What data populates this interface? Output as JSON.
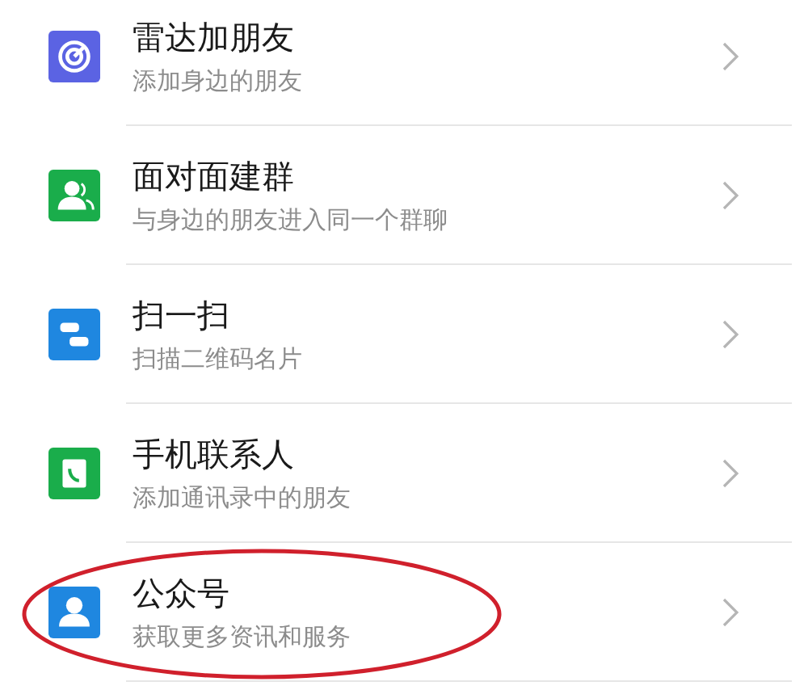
{
  "items": [
    {
      "kind": "radar",
      "color": "#5b63e3",
      "title": "雷达加朋友",
      "subtitle": "添加身边的朋友",
      "highlighted": false
    },
    {
      "kind": "group",
      "color": "#1aad4b",
      "title": "面对面建群",
      "subtitle": "与身边的朋友进入同一个群聊",
      "highlighted": false
    },
    {
      "kind": "scan",
      "color": "#1f87e0",
      "title": "扫一扫",
      "subtitle": "扫描二维码名片",
      "highlighted": false
    },
    {
      "kind": "phone",
      "color": "#1aad4b",
      "title": "手机联系人",
      "subtitle": "添加通讯录中的朋友",
      "highlighted": false
    },
    {
      "kind": "person",
      "color": "#1f87e0",
      "title": "公众号",
      "subtitle": "获取更多资讯和服务",
      "highlighted": true
    }
  ]
}
